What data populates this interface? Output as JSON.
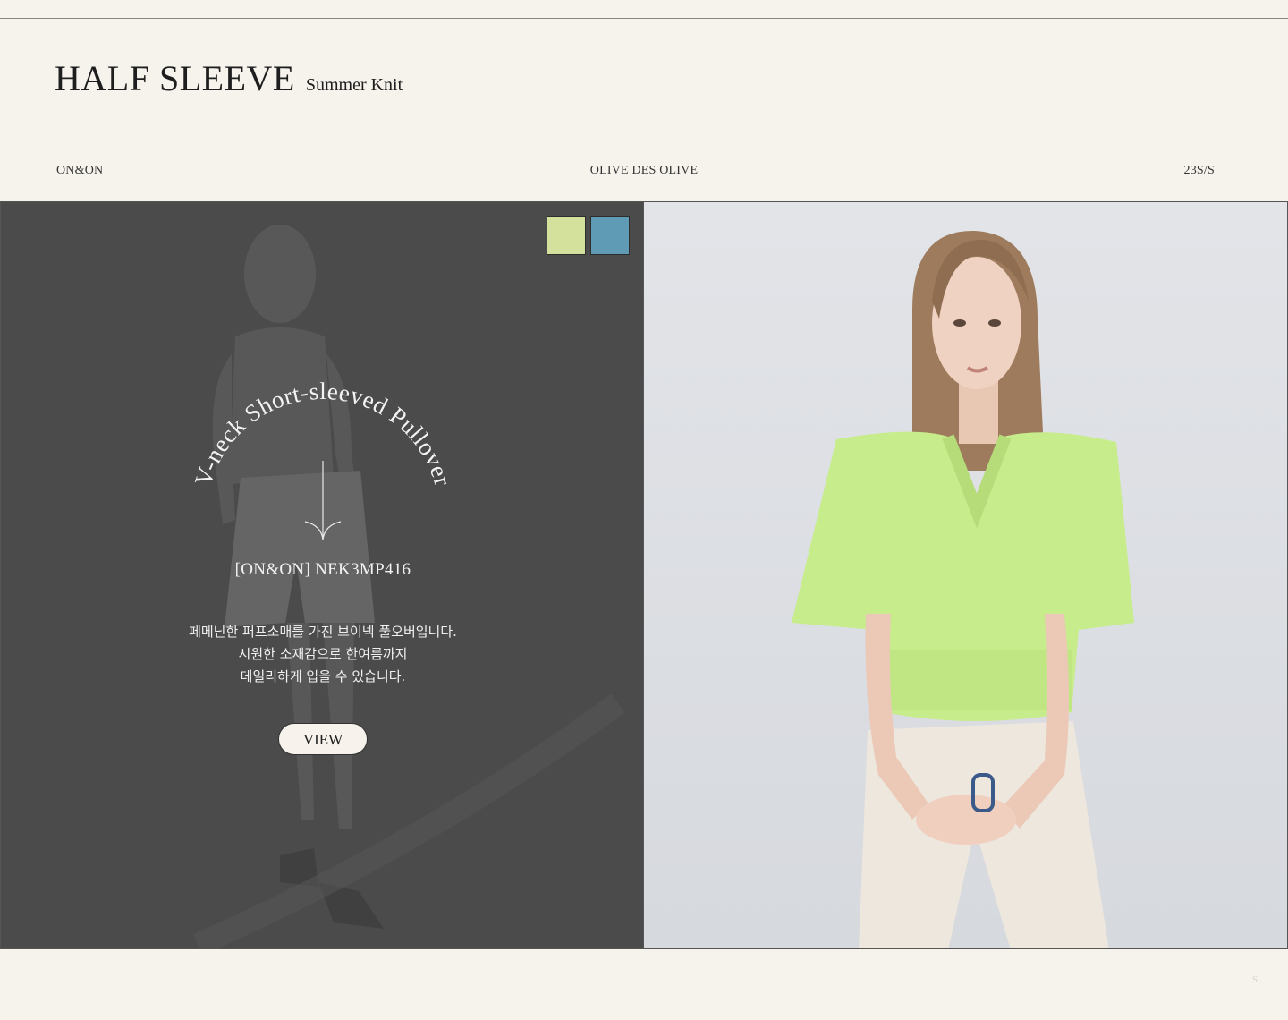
{
  "header": {
    "title": "HALF SLEEVE",
    "subtitle": "Summer Knit",
    "brand": "ON&ON",
    "collection": "OLIVE DES OLIVE",
    "season": "23S/S"
  },
  "product": {
    "arc_text": "V-neck Short-sleeved Pullover",
    "code": "[ON&ON] NEK3MP416",
    "description": [
      "페메닌한 퍼프소매를 가진 브이넥 풀오버입니다.",
      "시원한 소재감으로 한여름까지",
      "데일리하게 입을 수 있습니다."
    ],
    "view_label": "VIEW",
    "swatches": [
      "#d4e19c",
      "#5f9bb5"
    ]
  },
  "colors": {
    "background": "#f6f3ed",
    "panel_overlay": "#4b4b4b",
    "knit_green": "#c7ec8c"
  },
  "footer": {
    "mark": "S"
  }
}
